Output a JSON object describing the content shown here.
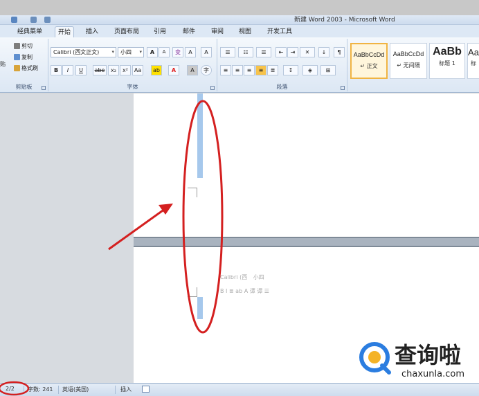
{
  "window": {
    "title": "新建 Word 2003 - Microsoft Word"
  },
  "tabs": [
    {
      "label": "经典菜单",
      "active": false
    },
    {
      "label": "开始",
      "active": true
    },
    {
      "label": "插入",
      "active": false
    },
    {
      "label": "页面布局",
      "active": false
    },
    {
      "label": "引用",
      "active": false
    },
    {
      "label": "邮件",
      "active": false
    },
    {
      "label": "审阅",
      "active": false
    },
    {
      "label": "视图",
      "active": false
    },
    {
      "label": "开发工具",
      "active": false
    }
  ],
  "clipboard": {
    "paste_label": "贴",
    "cut_label": "剪切",
    "copy_label": "复制",
    "format_painter_label": "格式刷",
    "group_label": "剪贴板"
  },
  "font": {
    "font_name": "Calibri (西文正文)",
    "font_size": "小四",
    "grow": "A",
    "shrink": "A",
    "phonetic": "变",
    "clear": "A",
    "bold": "B",
    "italic": "I",
    "underline": "U",
    "strike": "abe",
    "subscript": "x₂",
    "superscript": "x²",
    "change_case": "Aa",
    "highlight": "ab",
    "font_color": "A",
    "char_shade": "A",
    "enclose": "字",
    "group_label": "字体"
  },
  "paragraph": {
    "group_label": "段落"
  },
  "styles": [
    {
      "sample": "AaBbCcDd",
      "name": "↵ 正文",
      "selected": true
    },
    {
      "sample": "AaBbCcDd",
      "name": "↵ 无间隔",
      "selected": false
    },
    {
      "sample": "AaBb",
      "name": "标题 1",
      "selected": false
    },
    {
      "sample": "Aa",
      "name": "标",
      "selected": false
    }
  ],
  "mini_toolbar": {
    "font": "Calibri (西",
    "size": "小四",
    "row2": "B I ≣ ab A 谭 谭 ☰"
  },
  "status": {
    "page": "2/2",
    "words": "字数: 241",
    "language": "英语(美国)",
    "mode": "插入"
  },
  "watermark": {
    "name": "查询啦",
    "url": "chaxunla.com"
  },
  "colors": {
    "annotation": "#d42020",
    "accent": "#2b7de0",
    "highlight_yellow": "#ffe100",
    "font_red": "#e02020"
  }
}
